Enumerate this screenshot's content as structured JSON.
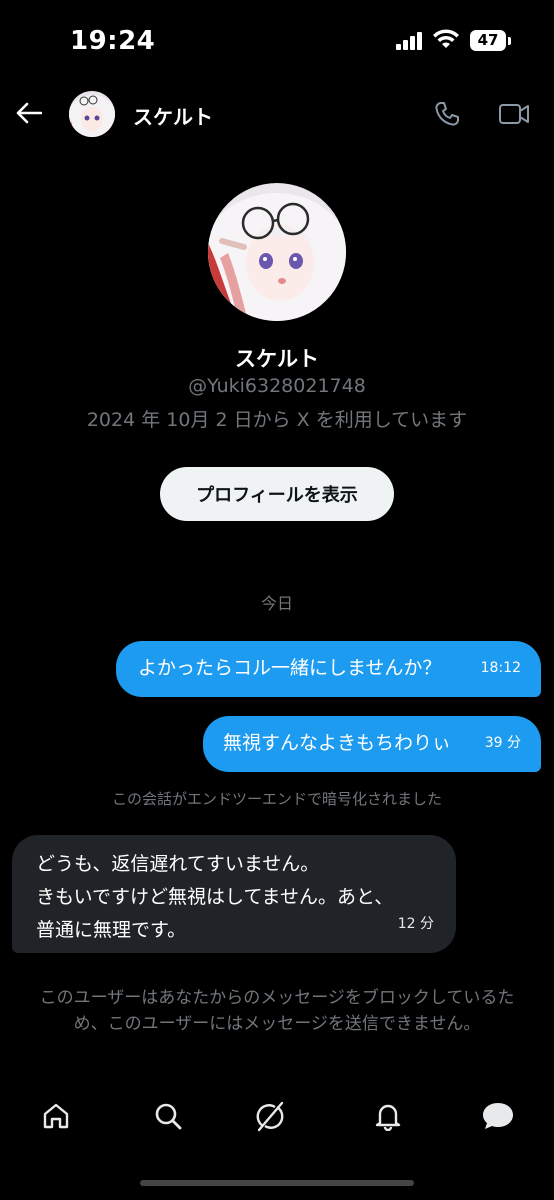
{
  "status_bar": {
    "time": "19:24",
    "battery": "47"
  },
  "header": {
    "name": "スケルト"
  },
  "profile": {
    "name": "スケルト",
    "handle": "@Yuki6328021748",
    "joined": "2024 年 10月 2 日から X を利用しています",
    "view_profile_label": "プロフィールを表示"
  },
  "conversation": {
    "date_separator": "今日",
    "messages": [
      {
        "direction": "outgoing",
        "text": "よかったらコル一緒にしませんか？",
        "time": "18:12"
      },
      {
        "direction": "outgoing",
        "text": "無視すんなよきもちわりぃ",
        "time": "39 分"
      },
      {
        "direction": "incoming",
        "lines": [
          "どうも、返信遅れてすいません。",
          "きもいですけど無視はしてません。あと、",
          "普通に無理です。"
        ],
        "time": "12 分"
      }
    ],
    "encryption_note": "この会話がエンドツーエンドで暗号化されました",
    "blocked_note": "このユーザーはあなたからのメッセージをブロックしているため、このユーザーにはメッセージを送信できません。"
  },
  "nav": [
    "home",
    "search",
    "grok",
    "notifications",
    "messages"
  ],
  "colors": {
    "accent": "#1d9bf0",
    "background": "#000000",
    "muted": "#71767b"
  }
}
